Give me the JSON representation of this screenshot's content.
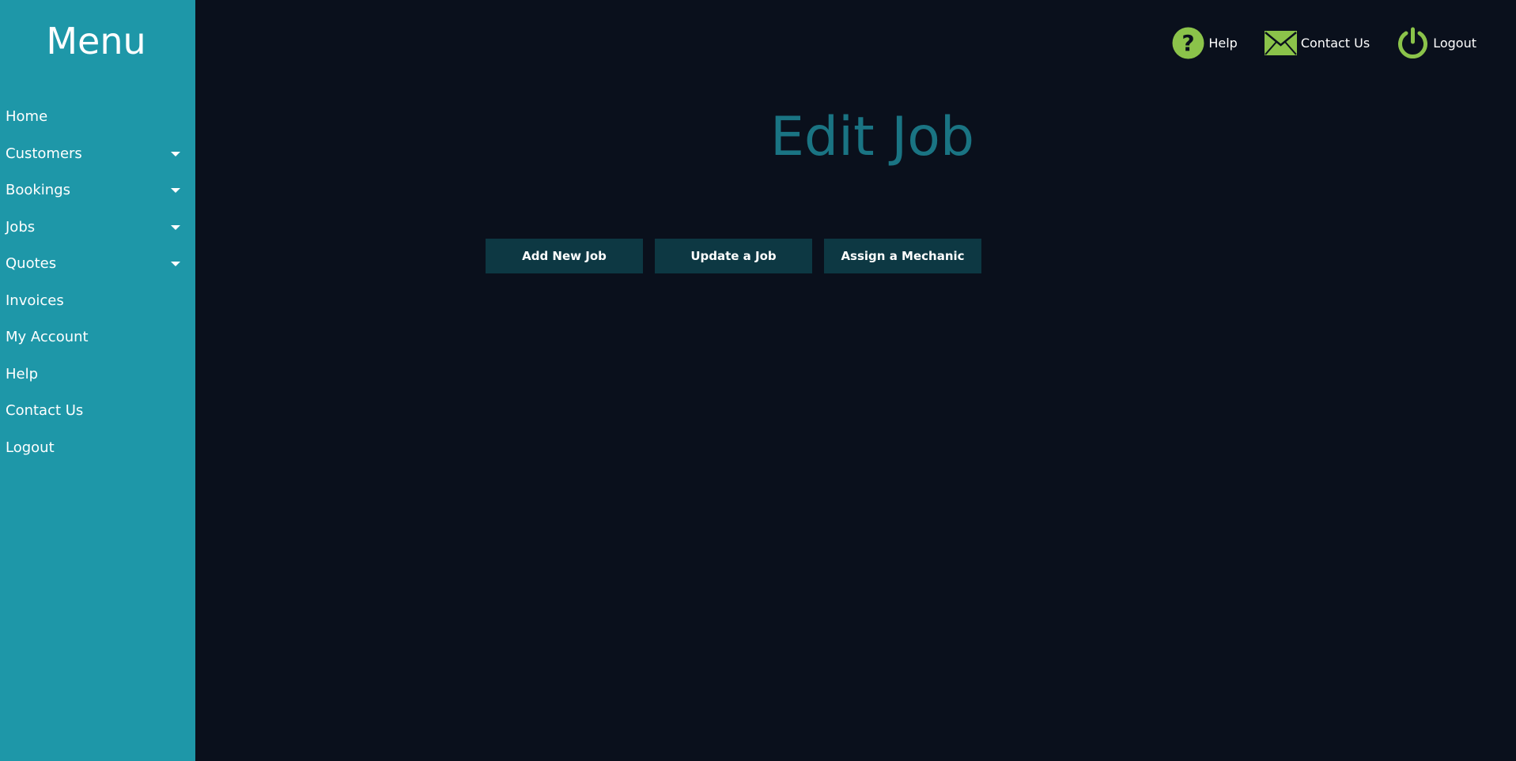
{
  "sidebar": {
    "title": "Menu",
    "items": [
      {
        "label": "Home",
        "has_dropdown": false
      },
      {
        "label": "Customers",
        "has_dropdown": true
      },
      {
        "label": "Bookings",
        "has_dropdown": true
      },
      {
        "label": "Jobs",
        "has_dropdown": true
      },
      {
        "label": "Quotes",
        "has_dropdown": true
      },
      {
        "label": "Invoices",
        "has_dropdown": false
      },
      {
        "label": "My Account",
        "has_dropdown": false
      },
      {
        "label": "Help",
        "has_dropdown": false
      },
      {
        "label": "Contact Us",
        "has_dropdown": false
      },
      {
        "label": "Logout",
        "has_dropdown": false
      }
    ]
  },
  "topbar": {
    "help": {
      "label": "Help",
      "icon": "help-icon"
    },
    "contact": {
      "label": "Contact Us",
      "icon": "envelope-icon"
    },
    "logout": {
      "label": "Logout",
      "icon": "power-icon"
    }
  },
  "main": {
    "title": "Edit Job",
    "buttons": {
      "add_new_job": "Add New Job",
      "update_job": "Update a Job",
      "assign_mechanic": "Assign a Mechanic"
    }
  },
  "colors": {
    "sidebar_bg": "#1e97a8",
    "page_bg": "#0a101c",
    "title": "#1a7483",
    "button_bg": "#0d3843",
    "icon_green": "#8bc34a"
  }
}
